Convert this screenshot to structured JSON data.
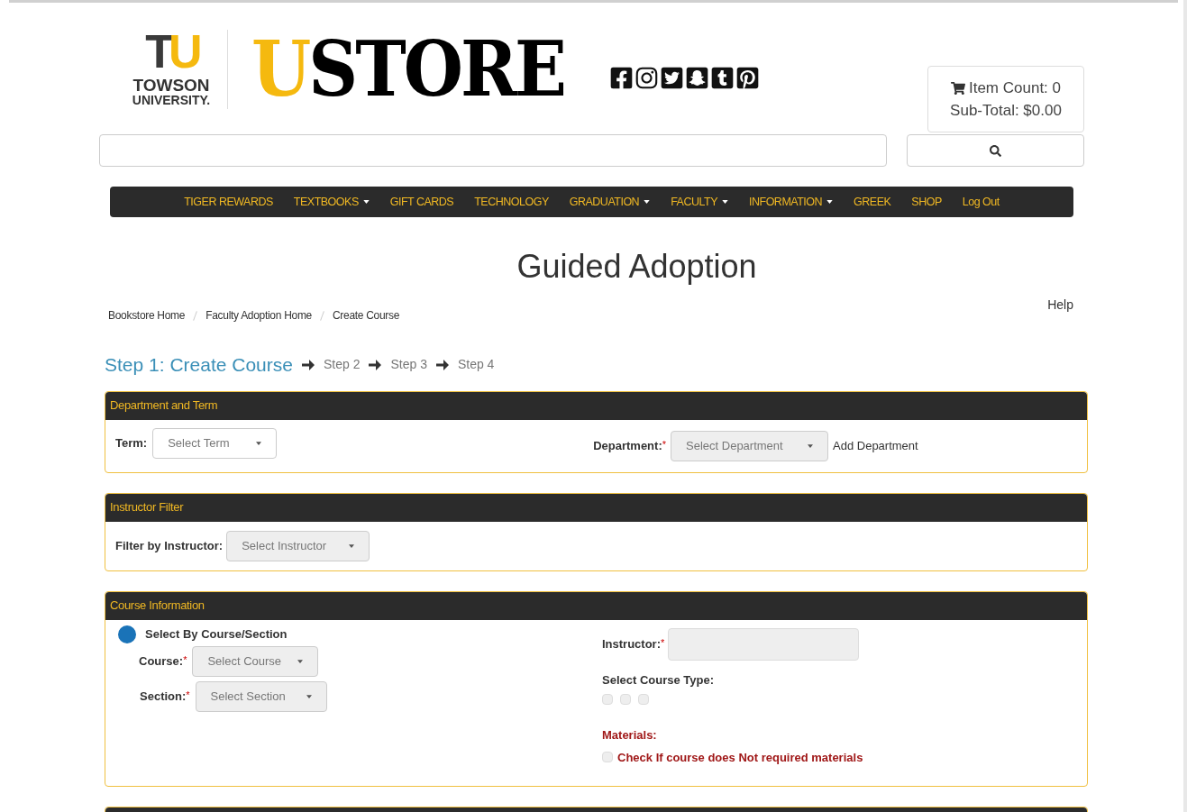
{
  "header": {
    "logo": {
      "mark_t": "T",
      "mark_u": "U",
      "line1": "TOWSON",
      "line2": "UNIVERSITY."
    },
    "store": {
      "first": "U",
      "rest": "STORE"
    },
    "cart": {
      "item_count": "Item Count: 0",
      "subtotal": "Sub-Total: $0.00"
    }
  },
  "nav": [
    {
      "label": "TIGER REWARDS",
      "dropdown": false
    },
    {
      "label": "TEXTBOOKS",
      "dropdown": true
    },
    {
      "label": "GIFT CARDS",
      "dropdown": false
    },
    {
      "label": "TECHNOLOGY",
      "dropdown": false
    },
    {
      "label": "GRADUATION",
      "dropdown": true
    },
    {
      "label": "FACULTY",
      "dropdown": true
    },
    {
      "label": "INFORMATION",
      "dropdown": true
    },
    {
      "label": "GREEK",
      "dropdown": false
    },
    {
      "label": "SHOP",
      "dropdown": false
    },
    {
      "label": "Log Out",
      "dropdown": false
    }
  ],
  "title": "Guided Adoption",
  "breadcrumb": [
    "Bookstore Home",
    "Faculty Adoption Home",
    "Create Course"
  ],
  "help": "Help",
  "steps": [
    {
      "label": "Step 1: Create Course",
      "selected": true
    },
    {
      "label": "Step 2",
      "selected": false
    },
    {
      "label": "Step 3",
      "selected": false
    },
    {
      "label": "Step 4",
      "selected": false
    }
  ],
  "department_term": {
    "title": "Department and Term",
    "term": {
      "label": "Term:",
      "value": "Select Term"
    },
    "department": {
      "label": "Department:",
      "required_mark": "*",
      "value": "Select Department"
    },
    "add_link": "Add Department"
  },
  "instructor_filter": {
    "title": "Instructor Filter",
    "filter": {
      "label": "Filter by Instructor:",
      "value": "Select Instructor"
    }
  },
  "course_info": {
    "title": "Course Information",
    "radio": {
      "label": "Select By Course/Section",
      "selected": true
    },
    "course": {
      "label": "Course:",
      "required_mark": "*",
      "value": "Select Course"
    },
    "section": {
      "label": "Section:",
      "required_mark": "*",
      "value": "Select Section"
    },
    "instructor": {
      "label": "Instructor:",
      "required_mark": "*"
    },
    "course_type": {
      "label": "Select Course Type:",
      "options": [
        {
          "checked": false
        },
        {
          "checked": false
        },
        {
          "checked": false
        }
      ]
    },
    "materials": {
      "label": "Materials:",
      "option": {
        "label": "Check If course does Not required materials",
        "checked": false
      }
    }
  }
}
